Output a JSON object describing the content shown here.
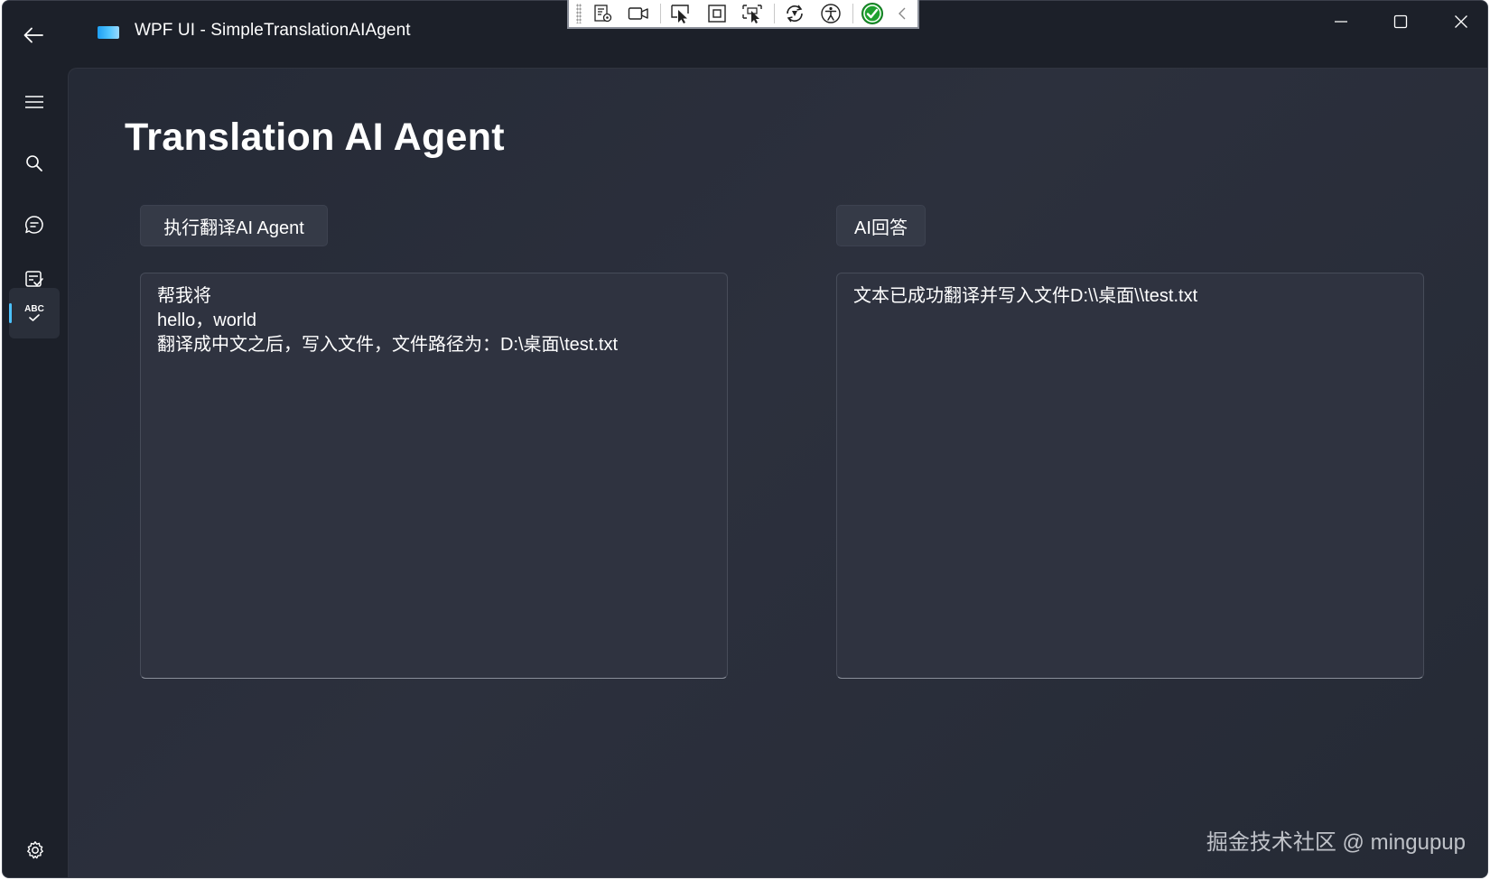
{
  "window": {
    "title": "WPF UI - SimpleTranslationAIAgent"
  },
  "devtools": {
    "items": [
      "live-visual-tree-icon",
      "record-icon",
      "select-element-icon",
      "display-layout-adorners-icon",
      "track-focus-icon",
      "hot-reload-icon",
      "accessibility-icon",
      "binding-status-icon",
      "collapse-icon"
    ]
  },
  "nav": {
    "items": [
      {
        "icon": "hamburger-menu-icon"
      },
      {
        "icon": "search-icon"
      },
      {
        "icon": "chat-icon"
      },
      {
        "icon": "task-list-icon"
      },
      {
        "icon": "spell-check-icon",
        "label": "ABC",
        "selected": true
      }
    ],
    "footer_icon": "settings-icon"
  },
  "page": {
    "title": "Translation AI Agent",
    "run_button_label": "执行翻译AI Agent",
    "answer_button_label": "AI回答",
    "input_text": "帮我将\nhello，world\n翻译成中文之后，写入文件，文件路径为：D:\\桌面\\test.txt",
    "output_text": "文本已成功翻译并写入文件D:\\\\桌面\\\\test.txt"
  },
  "watermark": "掘金技术社区 @ mingupup",
  "colors": {
    "accent": "#4cc2ff",
    "window_bg": "#1c2029",
    "content_bg": "#292d39"
  }
}
